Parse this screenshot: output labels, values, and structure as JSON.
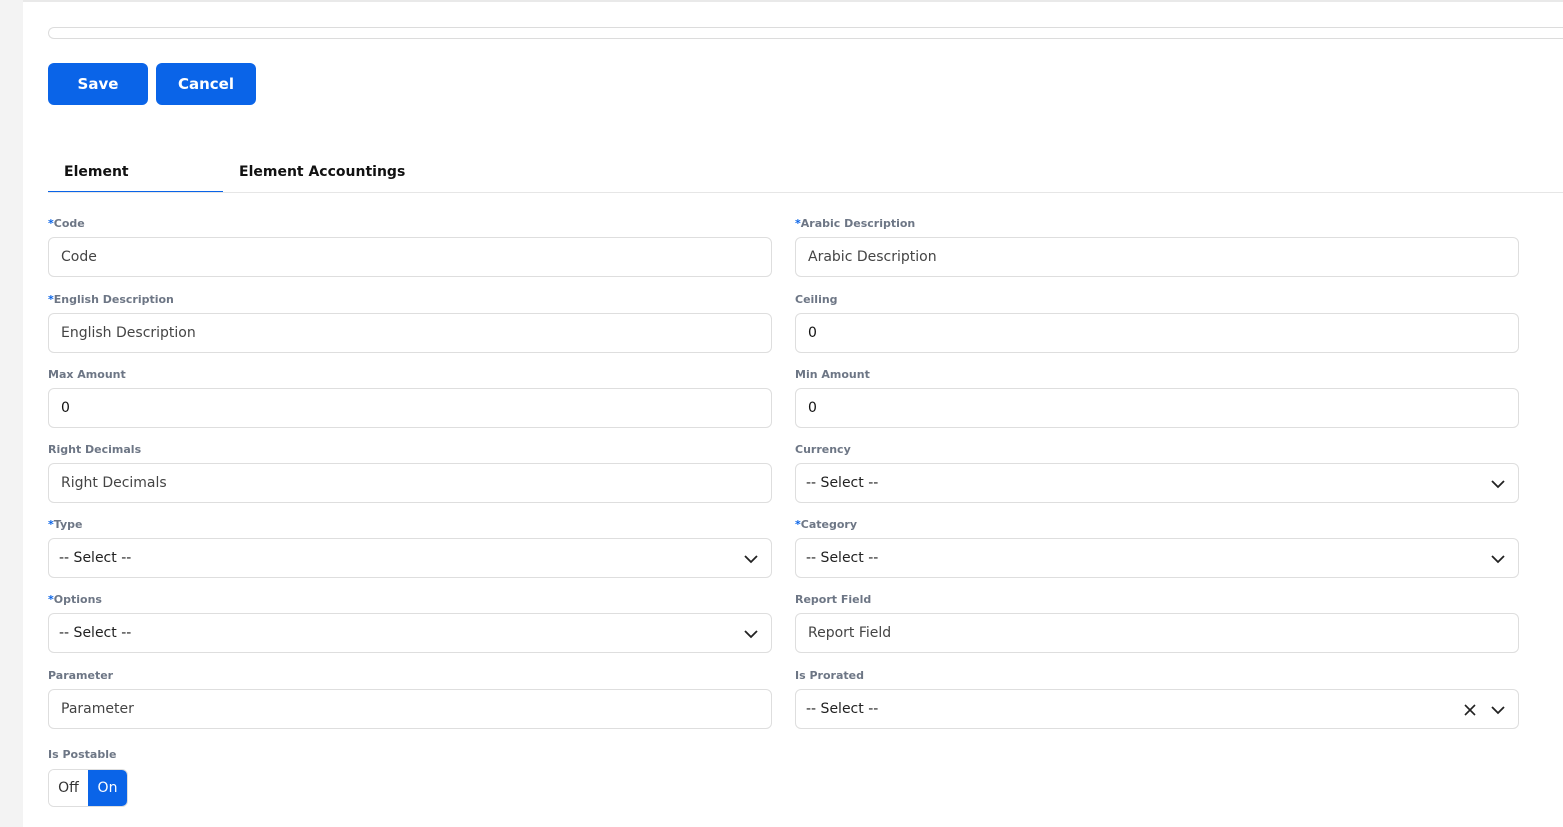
{
  "toolbar": {
    "save_label": "Save",
    "cancel_label": "Cancel"
  },
  "tabs": [
    {
      "label": "Element",
      "active": true
    },
    {
      "label": "Element Accountings",
      "active": false
    }
  ],
  "form": {
    "code": {
      "label": "Code",
      "required": true,
      "placeholder": "Code",
      "value": ""
    },
    "arabic_description": {
      "label": "Arabic Description",
      "required": true,
      "placeholder": "Arabic Description",
      "value": ""
    },
    "english_description": {
      "label": "English Description",
      "required": true,
      "placeholder": "English Description",
      "value": ""
    },
    "ceiling": {
      "label": "Ceiling",
      "required": false,
      "value": "0"
    },
    "max_amount": {
      "label": "Max Amount",
      "required": false,
      "value": "0"
    },
    "min_amount": {
      "label": "Min Amount",
      "required": false,
      "value": "0"
    },
    "right_decimals": {
      "label": "Right Decimals",
      "required": false,
      "placeholder": "Right Decimals",
      "value": ""
    },
    "currency": {
      "label": "Currency",
      "required": false,
      "selected": "-- Select --"
    },
    "type": {
      "label": "Type",
      "required": true,
      "selected": "-- Select --"
    },
    "category": {
      "label": "Category",
      "required": true,
      "selected": "-- Select --"
    },
    "options": {
      "label": "Options",
      "required": true,
      "selected": "-- Select --"
    },
    "report_field": {
      "label": "Report Field",
      "required": false,
      "placeholder": "Report Field",
      "value": ""
    },
    "parameter": {
      "label": "Parameter",
      "required": false,
      "placeholder": "Parameter",
      "value": ""
    },
    "is_prorated": {
      "label": "Is Prorated",
      "required": false,
      "selected": "-- Select --"
    },
    "is_postable": {
      "label": "Is Postable",
      "off_label": "Off",
      "on_label": "On",
      "value": "On"
    }
  },
  "required_marker": "*",
  "colors": {
    "accent": "#0a64e8",
    "label": "#6d7685",
    "border": "#dedede"
  },
  "icons": {
    "dropdown": "chevron-down-icon",
    "clear": "close-icon"
  }
}
